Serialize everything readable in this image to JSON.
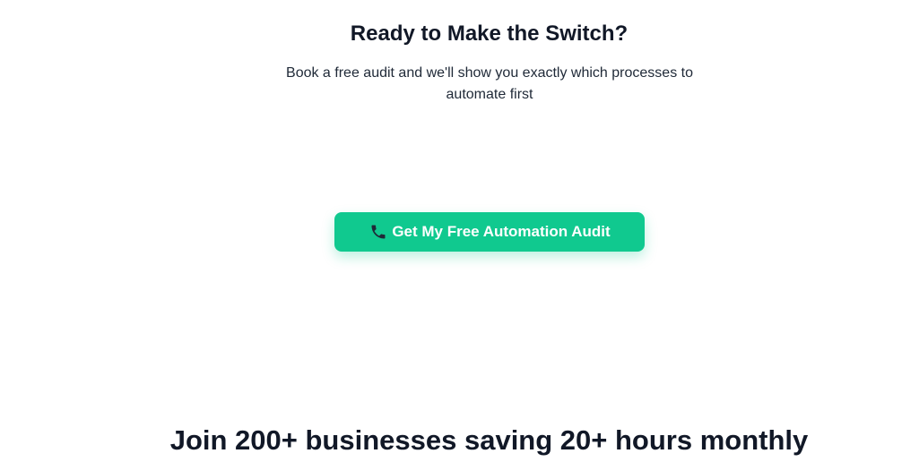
{
  "cta": {
    "title": "Ready to Make the Switch?",
    "subtitle": "Book a free audit and we'll show you exactly which processes to automate first",
    "button_label": "Get My Free Automation Audit",
    "button_icon": "phone-icon",
    "button_color": "#10c98f"
  },
  "social_proof": {
    "text": "Join 200+ businesses saving 20+ hours monthly"
  }
}
